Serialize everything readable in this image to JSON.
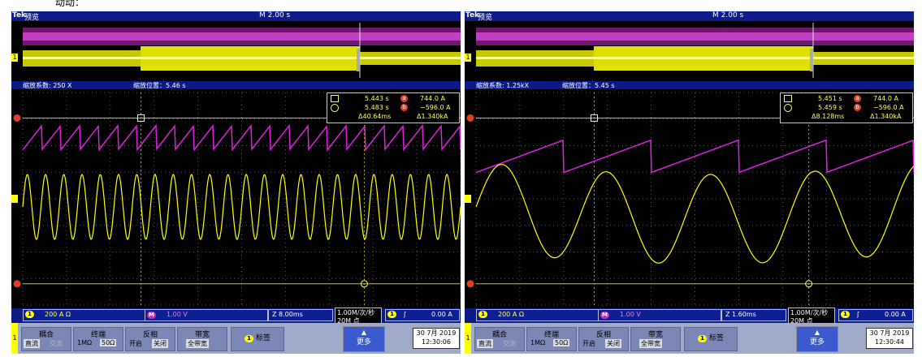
{
  "top_note": "动动：",
  "colors": {
    "ch1": "#ffff00",
    "math": "#e020e0",
    "grid": "#7a7a7a",
    "cursor": "#d4d400"
  },
  "scopes": [
    {
      "brand": "Tek",
      "mode": "预览",
      "timebase": "M 2.00 s",
      "zoom_factor": "缩放系数: 250 X",
      "zoom_position": "缩放位置：5.46 s",
      "cursor1_time": "5.443 s",
      "cursor1_val": "744.0 A",
      "cursor2_time": "5.483 s",
      "cursor2_val": "−596.0 A",
      "delta_t": "Δ40.64ms",
      "delta_v": "Δ1.340kA",
      "ch1_scale": "200 A  Ω",
      "math_scale": "1.00 V",
      "zoom_scale": "Z 8.00ms",
      "sample_rate": "1.00M/次/秒",
      "record_length": "20M 点",
      "trigger_level": "0.00 A",
      "menu": {
        "coupling_title": "耦合",
        "coupling_dc": "直流",
        "coupling_ac": "交流",
        "term_title": "终端",
        "term_1m": "1MΩ",
        "term_50": "50Ω",
        "invert_title": "反相",
        "invert_on": "开启",
        "invert_off": "关闭",
        "bw_title": "带宽",
        "bw_value": "全带宽",
        "label": "标签",
        "more": "更多"
      },
      "date": "30 7月 2019",
      "time": "12:30:06"
    },
    {
      "brand": "Tek",
      "mode": "预览",
      "timebase": "M 2.00 s",
      "zoom_factor": "缩放系数: 1.25kX",
      "zoom_position": "缩放位置：5.45 s",
      "cursor1_time": "5.451 s",
      "cursor1_val": "744.0 A",
      "cursor2_time": "5.459 s",
      "cursor2_val": "−596.0 A",
      "delta_t": "Δ8.128ms",
      "delta_v": "Δ1.340kA",
      "ch1_scale": "200 A  Ω",
      "math_scale": "1.00 V",
      "zoom_scale": "Z 1.60ms",
      "sample_rate": "1.00M/次/秒",
      "record_length": "20M 点",
      "trigger_level": "0.00 A",
      "menu": {
        "coupling_title": "耦合",
        "coupling_dc": "直流",
        "coupling_ac": "交流",
        "term_title": "终端",
        "term_1m": "1MΩ",
        "term_50": "50Ω",
        "invert_title": "反相",
        "invert_on": "开启",
        "invert_off": "关闭",
        "bw_title": "带宽",
        "bw_value": "全带宽",
        "label": "标签",
        "more": "更多"
      },
      "date": "30 7月 2019",
      "time": "12:30:44"
    }
  ]
}
